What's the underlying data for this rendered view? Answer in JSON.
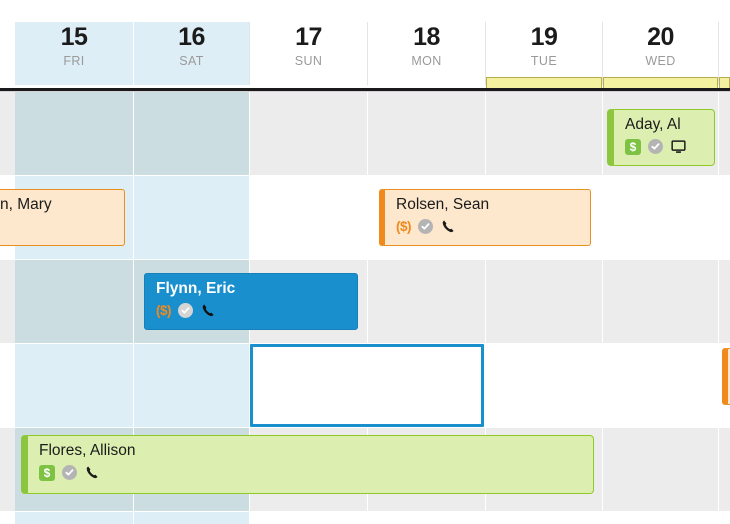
{
  "view": {
    "type": "week-calendar",
    "title": "Week view",
    "accent_color": "#1a8fce",
    "today_marker_color": "#f4f1a0"
  },
  "header": {
    "days": [
      {
        "num": "15",
        "dow": "FRI",
        "weekend": true,
        "marker": false
      },
      {
        "num": "16",
        "dow": "SAT",
        "weekend": true,
        "marker": false
      },
      {
        "num": "17",
        "dow": "SUN",
        "weekend": false,
        "marker": false
      },
      {
        "num": "18",
        "dow": "MON",
        "weekend": false,
        "marker": false
      },
      {
        "num": "19",
        "dow": "TUE",
        "weekend": false,
        "marker": true
      },
      {
        "num": "20",
        "dow": "WED",
        "weekend": false,
        "marker": true
      },
      {
        "num": "",
        "dow": "",
        "weekend": false,
        "marker": true
      }
    ]
  },
  "events": [
    {
      "id": "ev-aday",
      "title": "Aday, Al",
      "color": "green",
      "clipped_right": true,
      "icons": [
        "dollar-badge-icon",
        "check-circle-icon",
        "monitor-icon"
      ],
      "dollar_label": "$"
    },
    {
      "id": "ev-mary",
      "title": "n, Mary",
      "color": "orange",
      "clipped_left": true,
      "icons": [],
      "dollar_label": ""
    },
    {
      "id": "ev-rolsen",
      "title": "Rolsen, Sean",
      "color": "orange",
      "clipped_right": false,
      "icons": [
        "dollar-text-icon",
        "check-circle-icon",
        "phone-icon"
      ],
      "dollar_label": "($)"
    },
    {
      "id": "ev-flynn",
      "title": "Flynn, Eric",
      "color": "blue",
      "selected": true,
      "icons": [
        "dollar-text-icon",
        "check-circle-icon",
        "phone-icon"
      ],
      "dollar_label": "($)"
    },
    {
      "id": "ev-flores",
      "title": "Flores, Allison",
      "color": "green",
      "clipped_left": false,
      "icons": [
        "dollar-badge-icon",
        "check-circle-icon",
        "phone-icon"
      ],
      "dollar_label": "$"
    },
    {
      "id": "ev-edge",
      "title": "",
      "color": "orange",
      "clipped_left": true,
      "icons": [],
      "dollar_label": ""
    }
  ],
  "selection": {
    "active": true,
    "label": "",
    "border_color": "#1a8fce"
  }
}
